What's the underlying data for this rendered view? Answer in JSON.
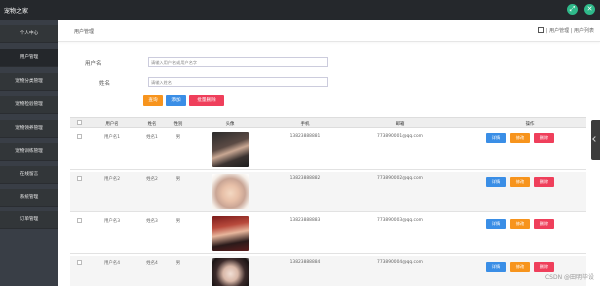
{
  "app": {
    "title": "宠物之家"
  },
  "topbar": {
    "expand_icon": "expand-icon",
    "close_icon": "close-icon",
    "accent": "#2fb98a"
  },
  "sidebar": {
    "items": [
      {
        "label": "个人中心"
      },
      {
        "label": "用户管理"
      },
      {
        "label": "宠物分类管理"
      },
      {
        "label": "宠物检验管理"
      },
      {
        "label": "宠物领养管理"
      },
      {
        "label": "宠物训练管理"
      },
      {
        "label": "在线留言"
      },
      {
        "label": "系统管理"
      },
      {
        "label": "订单管理"
      }
    ]
  },
  "breadcrumb": {
    "current": "用户管理",
    "path": "| 用户管理 | 用户列表",
    "home_icon": "home-icon"
  },
  "search": {
    "username_label": "用户名",
    "username_placeholder": "请输入用户名或用户名字",
    "name_label": "姓名",
    "name_placeholder": "请输入姓名"
  },
  "buttons": {
    "search": "查询",
    "add": "添加",
    "batch_delete": "批量删除"
  },
  "table": {
    "headers": [
      "用户名",
      "姓名",
      "性别",
      "头像",
      "手机",
      "邮箱",
      "操作"
    ],
    "rows": [
      {
        "username": "用户名1",
        "name": "姓名1",
        "gender": "男",
        "phone": "13823888881",
        "email": "773890001@qq.com"
      },
      {
        "username": "用户名2",
        "name": "姓名2",
        "gender": "男",
        "phone": "13823888882",
        "email": "773890002@qq.com"
      },
      {
        "username": "用户名3",
        "name": "姓名3",
        "gender": "男",
        "phone": "13823888883",
        "email": "773890003@qq.com"
      },
      {
        "username": "用户名4",
        "name": "姓名4",
        "gender": "男",
        "phone": "13823888884",
        "email": "773890004@qq.com"
      }
    ],
    "action_labels": {
      "detail": "详情",
      "edit": "修改",
      "delete": "删除"
    }
  },
  "colors": {
    "sidebar_bg": "#323639",
    "topbar_bg": "#25282c",
    "btn_orange": "#f7941d",
    "btn_blue": "#3a8ee6",
    "btn_red": "#ef3f5b"
  },
  "watermark": "CSDN @田明毕设"
}
